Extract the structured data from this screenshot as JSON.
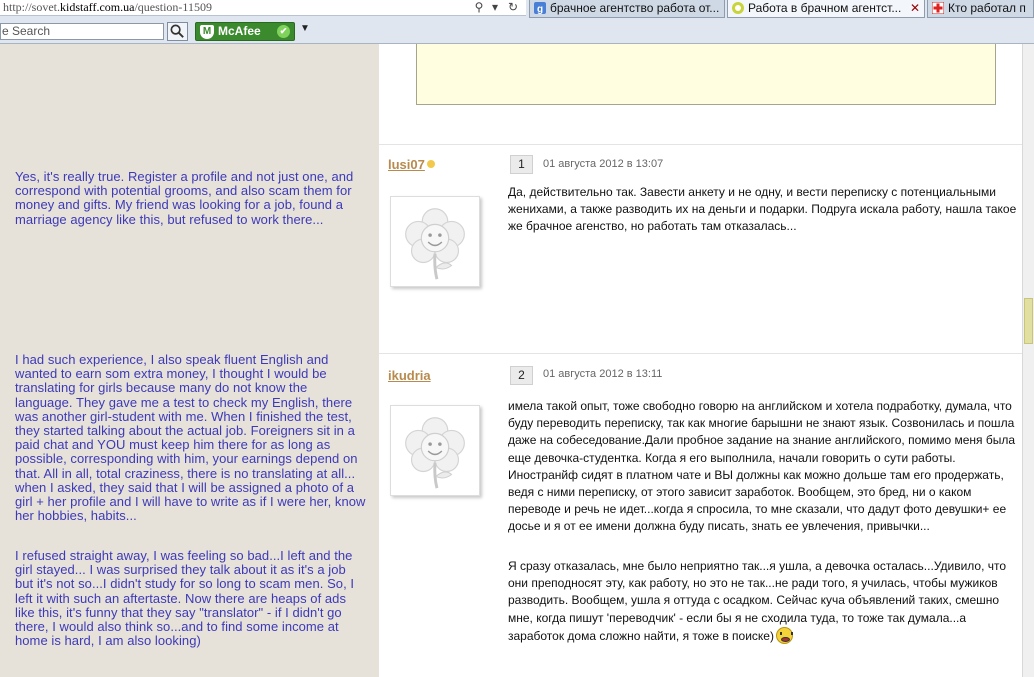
{
  "browser": {
    "url_prefix": "http://sovet.",
    "url_domain": "kidstaff.com.ua",
    "url_suffix": "/question-11509",
    "tabs": [
      {
        "label": "брачное агентство работа от...",
        "icon": "google-icon",
        "active": false
      },
      {
        "label": "Работа в брачном агентст...",
        "icon": "kidstaff-icon",
        "active": true
      },
      {
        "label": "Кто работал п",
        "icon": "red-cross-icon",
        "active": false
      }
    ],
    "search_placeholder": "e Search",
    "mcafee_label": "McAfee"
  },
  "translations": {
    "post1": "Yes, it's really true. Register a profile and not just one, and correspond with potential grooms, and also scam them for money and gifts. My friend was looking for a job, found a marriage agency like this, but refused to work there...",
    "post2_p1": "I had such experience, I also speak fluent English and wanted to earn som extra money, I thought I would be translating for girls because many do not know the language. They gave me a test to check my English, there was another girl-student with me. When I finished the test, they started talking about the actual job. Foreigners sit in a paid chat and YOU must keep him there for as long as possible, corresponding with him, your earnings depend on that. All in all, total craziness, there is no translating at all... when I asked, they said that I will be assigned a photo of a girl + her profile and I will have to write as if I were her, know her hobbies, habits...",
    "post2_p2": "I refused straight away, I was feeling so bad...I left and the girl stayed... I was surprised they talk about it as it's a job but it's not so...I didn't study for so long to scam men. So, I left it with such an aftertaste. Now there are heaps of ads like this, it's funny that they say \"translator\" - if I didn't go there, I would also think so...and to find some income at home is hard, I am also looking)"
  },
  "posts": [
    {
      "username": "lusi07",
      "number": "1",
      "date": "01 августа 2012 в 13:07",
      "text": "Да, действительно так. Завести анкету и не одну, и вести переписку с потенциальными женихами, а также разводить их на деньги и подарки. Подруга искала работу, нашла такое же брачное агенство, но работать там отказалась..."
    },
    {
      "username": "ikudria",
      "number": "2",
      "date": "01 августа 2012 в 13:11",
      "text_p1": "имела такой опыт, тоже свободно говорю на английском и хотела подработку, думала, что буду переводить переписку, так как многие барышни не знают язык. Созвонилась и пошла даже на собеседование.Дали пробное задание на знание английского, помимо меня была еще девочка-студентка. Когда я его выполнила, начали говорить о сути работы. Иностранйф сидят в платном чате и ВЫ должны как можно дольше там его продержать, ведя с ними переписку, от этого зависит заработок. Вообщем, это бред, ни о каком переводе и речь не идет...когда я спросила, то мне сказали, что дадут фото девушки+ ее досье и я от ее имени должна буду писать, знать ее увлечения, привычки...",
      "text_p2": "Я сразу отказалась, мне было неприятно так...я ушла, а девочка осталась...Удивило, что они преподносят эту, как работу, но это не так...не ради того, я училась, чтобы мужиков разводить. Вообщем, ушла я оттуда с осадком. Сейчас куча объявлений таких, смешно мне, когда пишут 'переводчик' - если бы я не сходила туда, то тоже так думала...а заработок дома сложно найти, я тоже в поиске)"
    }
  ],
  "colors": {
    "translation_text": "#3d3ab9",
    "left_panel_bg": "#e6e1d9",
    "username": "#b88a4e",
    "quote_bg": "#fffee0"
  }
}
